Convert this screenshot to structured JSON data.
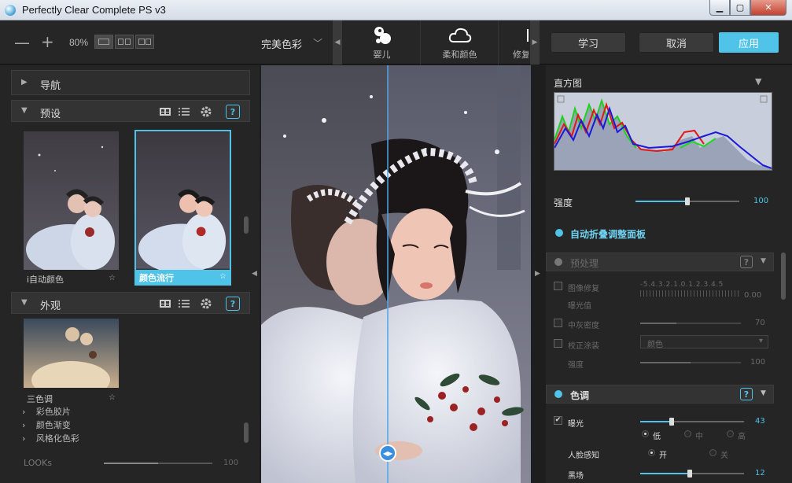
{
  "window": {
    "title": "Perfectly Clear Complete PS v3",
    "min": "▁",
    "max": "▢",
    "close": "✕"
  },
  "toolbar": {
    "zoom_out": "—",
    "zoom_in": "+",
    "zoom": "80%",
    "preset_name": "完美色彩",
    "preset_arrow": "﹀",
    "categories": [
      {
        "label": "婴儿",
        "icon": "baby-icon"
      },
      {
        "label": "柔和颜色",
        "icon": "cloud-icon"
      },
      {
        "label": "修复",
        "icon": "repair-icon"
      }
    ],
    "learn": "学习",
    "cancel": "取消",
    "apply": "应用",
    "strip_left": "◀",
    "strip_right": "▶"
  },
  "left": {
    "navigation": {
      "label": "导航",
      "arrow": "▶"
    },
    "presets": {
      "label": "预设",
      "arrow": "▼",
      "help": "?",
      "items": [
        {
          "caption": "i自动颜色",
          "selected": false
        },
        {
          "caption": "颜色流行",
          "selected": true
        }
      ]
    },
    "looks_section": {
      "label": "外观",
      "arrow": "▼",
      "help": "?",
      "thumb_caption": "三色调",
      "subitems": [
        "彩色胶片",
        "颜色渐变",
        "风格化色彩"
      ],
      "sub_arrow": "›",
      "looks_label": "LOOKs",
      "looks_value": "100",
      "looks_level": 0.5
    },
    "star": "☆"
  },
  "right": {
    "histogram_label": "直方图",
    "histogram_arrow": "▼",
    "strength_label": "强度",
    "strength_value": "100",
    "strength_level": 0.5,
    "auto_collapse": "自动折叠调整面板",
    "preprocess": {
      "label": "预处理",
      "help": "?",
      "arrow": "▼",
      "image_repair": "图像修复",
      "exposure_value_label": "曝光值",
      "exposure_scale": "-5.4.3.2.1.0.1.2.3.4.5",
      "exposure_value": "0.00",
      "neutral_density": "中灰密度",
      "neutral_density_value": "70",
      "lens_correction": "校正涂装",
      "lens_select": "颜色",
      "lens_select_arrow": "▾",
      "intensity_label": "强度",
      "intensity_value": "100"
    },
    "tone": {
      "label": "色调",
      "help": "?",
      "arrow": "▼",
      "exposure": "曝光",
      "exposure_value": "43",
      "exposure_level": 0.3,
      "check": "✔",
      "levels": [
        "低",
        "中",
        "高"
      ],
      "face_aware": "人脸感知",
      "face_on": "开",
      "face_off": "关",
      "black_point": "黑场",
      "black_value": "12",
      "black_level": 0.48
    }
  },
  "preview": {
    "split_handle": "◀▶",
    "left_arrow": "◀",
    "right_arrow": "▶"
  },
  "colors": {
    "accent": "#4fc3e8"
  }
}
